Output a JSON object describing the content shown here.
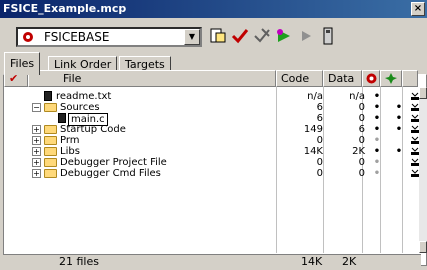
{
  "window": {
    "title": "FSICE_Example.mcp",
    "close": "×"
  },
  "toolbar": {
    "target": "FSICEBASE",
    "dropdown": "▼"
  },
  "tabs": [
    {
      "label": "Files"
    },
    {
      "label": "Link Order"
    },
    {
      "label": "Targets"
    }
  ],
  "columns": {
    "check": "✔",
    "file": "File",
    "code": "Code",
    "data": "Data"
  },
  "rows": [
    {
      "name": "readme.txt",
      "code": "n/a",
      "data": "n/a",
      "dot1": "•",
      "dot2": ""
    },
    {
      "name": "Sources",
      "expander": "−",
      "code": "6",
      "data": "0",
      "dot1": "•",
      "dot2": "•"
    },
    {
      "name": "main.c",
      "code": "6",
      "data": "0",
      "dot1": "•",
      "dot2": "•"
    },
    {
      "name": "Startup Code",
      "expander": "+",
      "code": "149",
      "data": "6",
      "dot1": "•",
      "dot2": "•"
    },
    {
      "name": "Prm",
      "expander": "+",
      "code": "0",
      "data": "0",
      "dot1": "•",
      "dot2": ""
    },
    {
      "name": "Libs",
      "expander": "+",
      "code": "14K",
      "data": "2K",
      "dot1": "•",
      "dot2": "•"
    },
    {
      "name": "Debugger Project File",
      "expander": "+",
      "code": "0",
      "data": "0",
      "dot1": "•",
      "dot2": ""
    },
    {
      "name": "Debugger Cmd Files",
      "expander": "+",
      "code": "0",
      "data": "0",
      "dot1": "•",
      "dot2": ""
    }
  ],
  "footer": {
    "files": "21 files",
    "code": "14K",
    "data": "2K"
  }
}
